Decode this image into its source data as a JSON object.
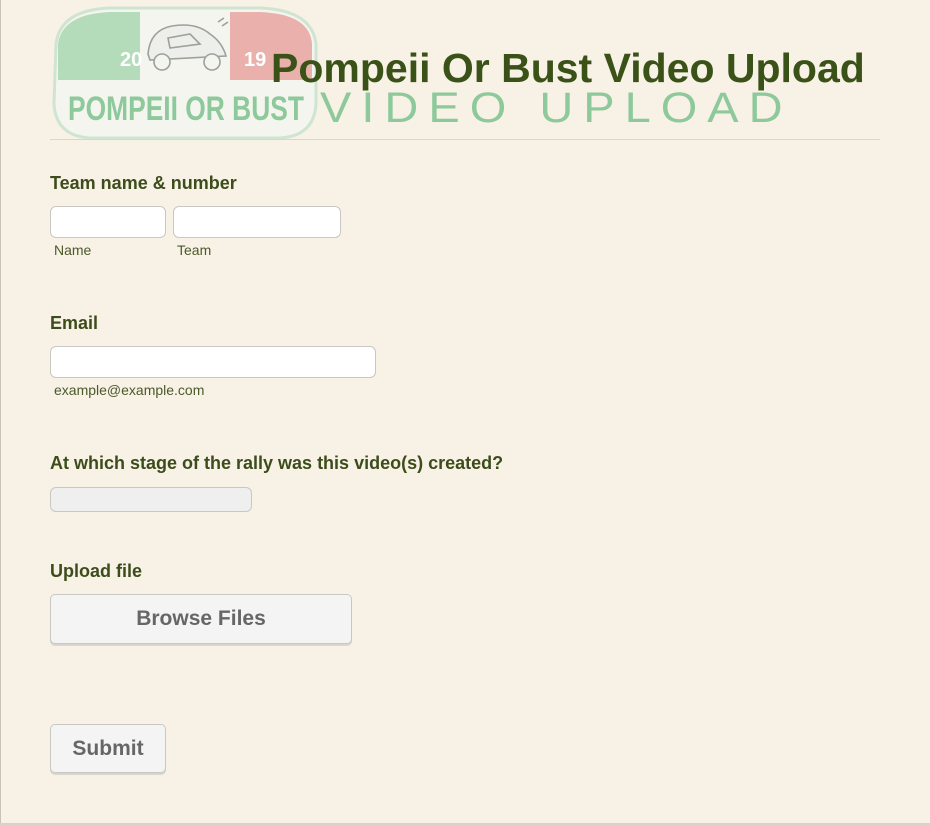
{
  "header": {
    "title": "Pompeii Or Bust Video Upload",
    "banner_text": "VIDEO UPLOAD",
    "logo": {
      "text": "POMPEII OR BUST",
      "year_left": "20",
      "year_right": "19",
      "icon": "vintage-car-icon"
    }
  },
  "form": {
    "team": {
      "label": "Team name & number",
      "name_sublabel": "Name",
      "team_sublabel": "Team",
      "name_value": "",
      "team_value": ""
    },
    "email": {
      "label": "Email",
      "value": "",
      "sublabel": "example@example.com"
    },
    "stage": {
      "label": "At which stage of the rally was this video(s) created?",
      "selected": ""
    },
    "upload": {
      "label": "Upload file",
      "button_label": "Browse Files"
    },
    "submit_label": "Submit"
  },
  "colors": {
    "background": "#f8f1e6",
    "label": "#3c4d1b",
    "title": "#3a5218",
    "banner_green": "#8dc99a",
    "logo_red": "#e8a3a0",
    "logo_green": "#a8d6b0"
  }
}
